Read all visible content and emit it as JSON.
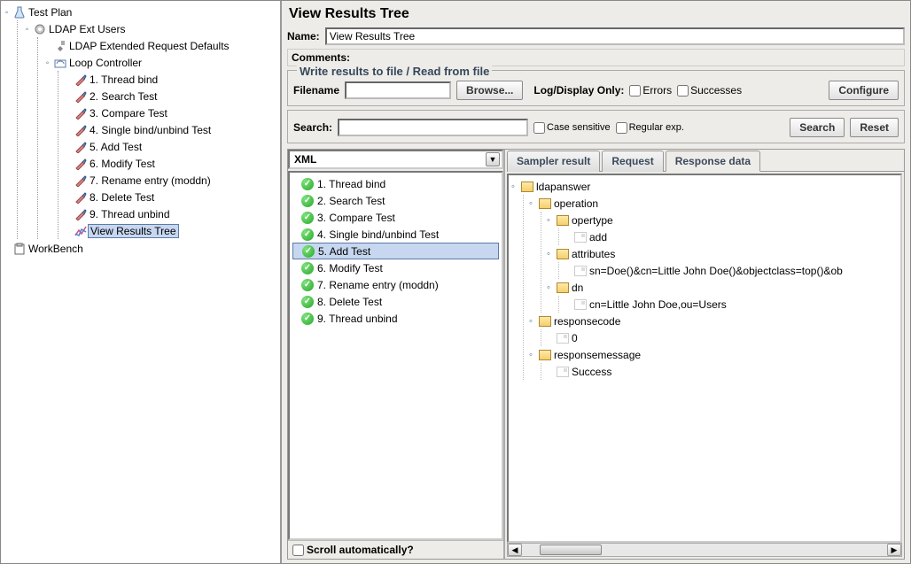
{
  "left_tree": {
    "root": "Test Plan",
    "nodes": [
      {
        "label": "LDAP Ext Users",
        "children": [
          {
            "label": "LDAP Extended Request Defaults",
            "icon": "wrench"
          },
          {
            "label": "Loop Controller",
            "icon": "loop",
            "children": [
              {
                "label": "1. Thread bind",
                "icon": "pen"
              },
              {
                "label": "2. Search Test",
                "icon": "pen"
              },
              {
                "label": "3. Compare Test",
                "icon": "pen"
              },
              {
                "label": "4. Single bind/unbind Test",
                "icon": "pen"
              },
              {
                "label": "5. Add Test",
                "icon": "pen"
              },
              {
                "label": "6. Modify Test",
                "icon": "pen"
              },
              {
                "label": "7. Rename entry (moddn)",
                "icon": "pen"
              },
              {
                "label": "8. Delete Test",
                "icon": "pen"
              },
              {
                "label": "9. Thread unbind",
                "icon": "pen"
              },
              {
                "label": "View Results Tree",
                "icon": "graph",
                "selected": true
              }
            ]
          }
        ]
      }
    ],
    "workbench": "WorkBench"
  },
  "title": "View Results Tree",
  "fields": {
    "name_label": "Name:",
    "name_value": "View Results Tree",
    "comments_label": "Comments:"
  },
  "file_box": {
    "legend": "Write results to file / Read from file",
    "filename_label": "Filename",
    "browse": "Browse...",
    "logdisplay": "Log/Display Only:",
    "errors": "Errors",
    "successes": "Successes",
    "configure": "Configure"
  },
  "search_box": {
    "label": "Search:",
    "case": "Case sensitive",
    "regex": "Regular exp.",
    "search_btn": "Search",
    "reset_btn": "Reset"
  },
  "renderer": {
    "selected": "XML"
  },
  "samples": [
    "1. Thread bind",
    "2. Search Test",
    "3. Compare Test",
    "4. Single bind/unbind Test",
    "5. Add Test",
    "6. Modify Test",
    "7. Rename entry (moddn)",
    "8. Delete Test",
    "9. Thread unbind"
  ],
  "selected_sample_index": 4,
  "auto_scroll": "Scroll automatically?",
  "tabs": {
    "sampler": "Sampler result",
    "request": "Request",
    "response": "Response data"
  },
  "response_tree": {
    "root": "ldapanswer",
    "children": [
      {
        "label": "operation",
        "children": [
          {
            "label": "opertype",
            "children": [
              {
                "label": "add",
                "leaf": true
              }
            ]
          },
          {
            "label": "attributes",
            "children": [
              {
                "label": "sn=Doe()&cn=Little John Doe()&objectclass=top()&ob",
                "leaf": true
              }
            ]
          },
          {
            "label": "dn",
            "children": [
              {
                "label": "cn=Little John Doe,ou=Users",
                "leaf": true
              }
            ]
          }
        ]
      },
      {
        "label": "responsecode",
        "children": [
          {
            "label": "0",
            "leaf": true
          }
        ]
      },
      {
        "label": "responsemessage",
        "children": [
          {
            "label": "Success",
            "leaf": true
          }
        ]
      }
    ]
  }
}
